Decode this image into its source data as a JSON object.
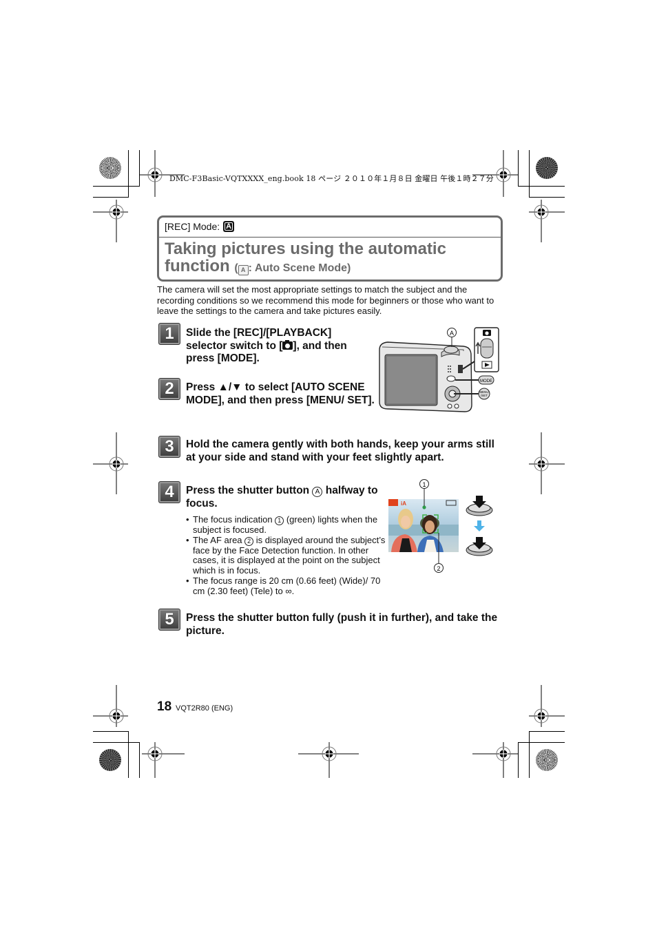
{
  "printer_header": "DMC-F3Basic-VQTXXXX_eng.book  18 ページ  ２０１０年１月８日  金曜日  午後１時２７分",
  "title_box": {
    "rec_mode_label": "[REC] Mode:",
    "mode_icon": "A",
    "title_line1": "Taking pictures using the automatic",
    "title_line2": "function",
    "title_sub_open": "(",
    "title_sub_icon": "A",
    "title_sub_text": ": Auto Scene Mode)"
  },
  "intro": "The camera will set the most appropriate settings to match the subject and the recording conditions so we recommend this mode for beginners or those who want to leave the settings to the camera and take pictures easily.",
  "steps": [
    {
      "number": "1",
      "text_a": "Slide the [REC]/[PLAYBACK] selector switch to [",
      "icon": "camera-icon",
      "text_b": "], and then press [MODE]."
    },
    {
      "number": "2",
      "text": "Press ▲/▼ to select [AUTO SCENE MODE], and then press [MENU/ SET]."
    },
    {
      "number": "3",
      "text": "Hold the camera gently with both hands, keep your arms still at your side and stand with your feet slightly apart."
    },
    {
      "number": "4",
      "text_a": "Press the shutter button ",
      "marker": "A",
      "text_b": " halfway to focus.",
      "bullets": [
        {
          "a": "The focus indication ",
          "marker": "1",
          "b": " (green) lights when the subject is focused."
        },
        {
          "a": "The AF area ",
          "marker": "2",
          "b": " is displayed around the subject’s face by the Face Detection function. In other cases, it is displayed at the point on the subject which is in focus."
        },
        {
          "a": "The focus range is 20 cm (0.66 feet) (Wide)/ 70 cm (2.30 feet) (Tele) to ∞.",
          "marker": null,
          "b": ""
        }
      ]
    },
    {
      "number": "5",
      "text": "Press the shutter button fully (push it in further), and take the picture."
    }
  ],
  "camera_illustration": {
    "label_a": "A",
    "mode_button": "MODE",
    "menu_button": "MENU /SET"
  },
  "focus_illustration": {
    "label_1": "1",
    "label_2": "2",
    "focus_indicator_color": "#2e9b4a",
    "af_frame_color": "#3cb043",
    "arrow_color": "#4fb3e8"
  },
  "footer": {
    "page_number": "18",
    "code": "VQT2R80 (ENG)"
  }
}
